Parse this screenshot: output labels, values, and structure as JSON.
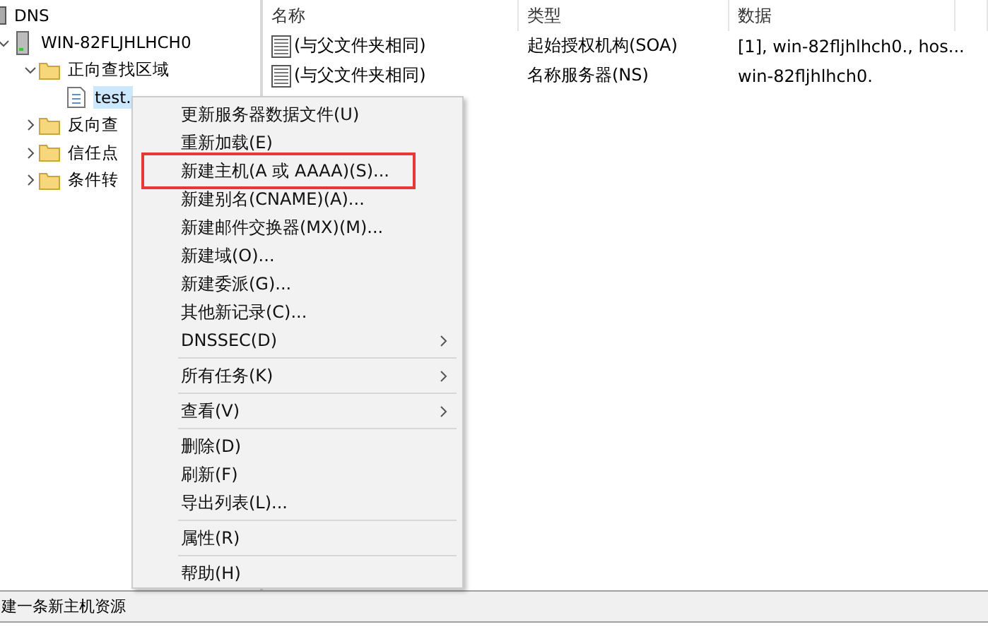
{
  "tree": [
    {
      "label": "DNS",
      "children": [
        {
          "label": "WIN-82FLJHLHCH0",
          "expanded": true,
          "children": [
            {
              "label": "正向查找区域",
              "expanded": true,
              "children": [
                {
                  "label": "test.",
                  "selected": true
                }
              ]
            },
            {
              "label": "反向查",
              "expanded": false
            },
            {
              "label": "信任点",
              "expanded": false
            },
            {
              "label": "条件转",
              "expanded": false
            }
          ]
        }
      ]
    }
  ],
  "list": {
    "columns": [
      "名称",
      "类型",
      "数据"
    ],
    "rows": [
      [
        "(与父文件夹相同)",
        "起始授权机构(SOA)",
        "[1], win-82fljhlhch0., hos..."
      ],
      [
        "(与父文件夹相同)",
        "名称服务器(NS)",
        "win-82fljhlhch0."
      ]
    ]
  },
  "context_menu": [
    {
      "kind": "item",
      "label": "更新服务器数据文件(U)",
      "submenu": false,
      "annotated": false
    },
    {
      "kind": "item",
      "label": "重新加载(E)",
      "submenu": false,
      "annotated": false
    },
    {
      "kind": "item",
      "label": "新建主机(A 或 AAAA)(S)...",
      "submenu": false,
      "annotated": true
    },
    {
      "kind": "item",
      "label": "新建别名(CNAME)(A)...",
      "submenu": false,
      "annotated": false
    },
    {
      "kind": "item",
      "label": "新建邮件交换器(MX)(M)...",
      "submenu": false,
      "annotated": false
    },
    {
      "kind": "item",
      "label": "新建域(O)...",
      "submenu": false,
      "annotated": false
    },
    {
      "kind": "item",
      "label": "新建委派(G)...",
      "submenu": false,
      "annotated": false
    },
    {
      "kind": "item",
      "label": "其他新记录(C)...",
      "submenu": false,
      "annotated": false
    },
    {
      "kind": "item",
      "label": "DNSSEC(D)",
      "submenu": true,
      "annotated": false
    },
    {
      "kind": "separator"
    },
    {
      "kind": "item",
      "label": "所有任务(K)",
      "submenu": true,
      "annotated": false
    },
    {
      "kind": "separator"
    },
    {
      "kind": "item",
      "label": "查看(V)",
      "submenu": true,
      "annotated": false
    },
    {
      "kind": "separator"
    },
    {
      "kind": "item",
      "label": "删除(D)",
      "submenu": false,
      "annotated": false
    },
    {
      "kind": "item",
      "label": "刷新(F)",
      "submenu": false,
      "annotated": false
    },
    {
      "kind": "item",
      "label": "导出列表(L)...",
      "submenu": false,
      "annotated": false
    },
    {
      "kind": "separator"
    },
    {
      "kind": "item",
      "label": "属性(R)",
      "submenu": false,
      "annotated": false
    },
    {
      "kind": "separator"
    },
    {
      "kind": "item",
      "label": "帮助(H)",
      "submenu": false,
      "annotated": false
    }
  ],
  "status_bar": "建一条新主机资源"
}
